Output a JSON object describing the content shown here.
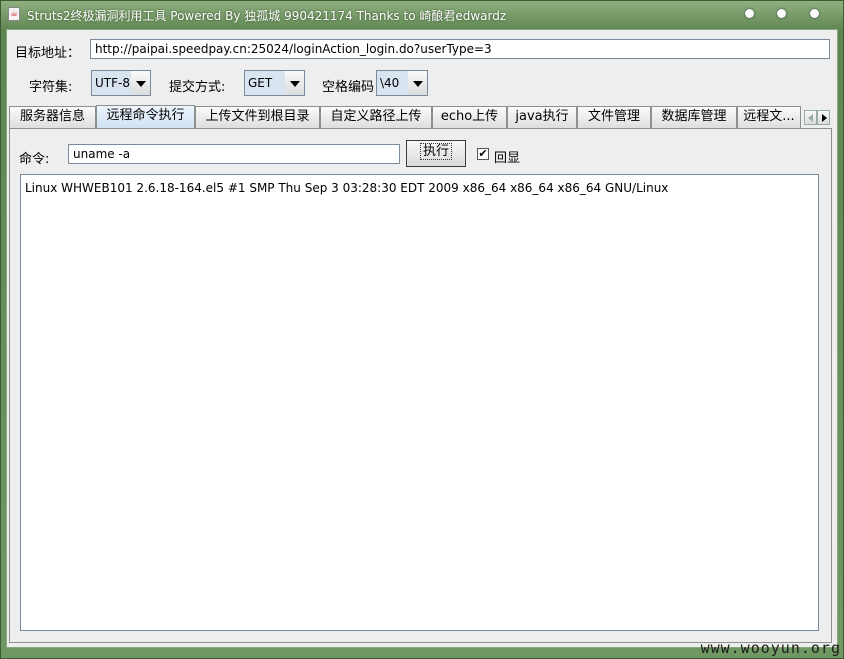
{
  "window": {
    "title": "Struts2终极漏洞利用工具  Powered By 独孤城 990421174 Thanks to 崎酿君edwardz",
    "icon_name": "java-app-icon"
  },
  "target": {
    "label": "目标地址：",
    "url": "http://paipai.speedpay.cn:25024/loginAction_login.do?userType=3"
  },
  "options": {
    "charset_label": "字符集:",
    "charset_value": "UTF-8",
    "method_label": "提交方式:",
    "method_value": "GET",
    "space_label": "空格编码",
    "space_value": "\\40"
  },
  "tabs": [
    {
      "label": "服务器信息"
    },
    {
      "label": "远程命令执行",
      "active": true
    },
    {
      "label": "上传文件到根目录"
    },
    {
      "label": "自定义路径上传"
    },
    {
      "label": "echo上传"
    },
    {
      "label": "java执行"
    },
    {
      "label": "文件管理"
    },
    {
      "label": "数据库管理"
    },
    {
      "label": "远程文..."
    }
  ],
  "command_panel": {
    "command_label": "命令:",
    "command_value": "uname -a",
    "execute_label": "执行",
    "echo_label": "回显",
    "echo_checked": true,
    "output": "Linux WHWEB101 2.6.18-164.el5 #1 SMP Thu Sep 3 03:28:30 EDT 2009 x86_64 x86_64 x86_64 GNU/Linux"
  },
  "watermark": "www.wooyun.org",
  "colors": {
    "titlebar": "#6f9862",
    "active_tab": "#cfe2f3"
  }
}
